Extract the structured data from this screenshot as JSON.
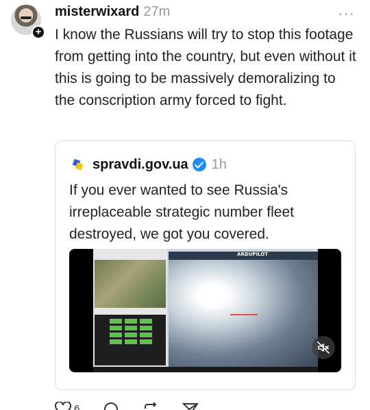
{
  "post": {
    "username": "misterwixard",
    "time": "27m",
    "more_icon": "more-horizontal-icon",
    "text": "I know the Russians will try to stop this footage from getting into the country, but even without it this is going to be massively demoralizing to the conscription army forced to fight."
  },
  "quote": {
    "username": "spravdi.gov.ua",
    "verified": true,
    "time": "1h",
    "text": "If you ever wanted to see Russia's irreplaceable strategic number fleet destroyed, we got you covered.",
    "video": {
      "overlay_logo": "ARDUPILOT",
      "muted": true
    }
  },
  "actions": {
    "like_count": "6",
    "items": [
      "heart-icon",
      "comment-icon",
      "repost-icon",
      "share-icon"
    ]
  },
  "colors": {
    "verified": "#1d8cf8",
    "flag_blue": "#2a5bd7",
    "flag_yellow": "#f7c600",
    "muted_text": "#999999"
  }
}
